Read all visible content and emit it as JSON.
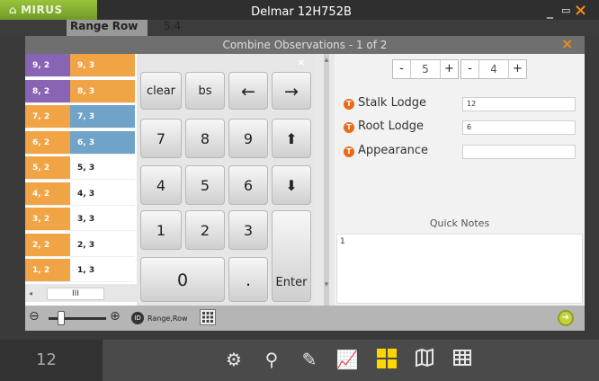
{
  "app": {
    "logo": "MIRUS",
    "title": "Delmar 12H752B"
  },
  "background": {
    "range_row_header": "Range Row",
    "number": "5.4"
  },
  "dialog": {
    "title": "Combine Observations - 1 of 2",
    "grid": {
      "rows": [
        {
          "left": "9, 2",
          "left_color": "purple",
          "right": "9, 3",
          "right_color": "orange"
        },
        {
          "left": "8, 2",
          "left_color": "purple",
          "right": "8, 3",
          "right_color": "orange"
        },
        {
          "left": "7, 2",
          "left_color": "orange",
          "right": "7, 3",
          "right_color": "blue"
        },
        {
          "left": "6, 2",
          "left_color": "orange",
          "right": "6, 3",
          "right_color": "blue"
        },
        {
          "left": "5, 2",
          "left_color": "orange",
          "right": "5, 3",
          "right_color": "white"
        },
        {
          "left": "4, 2",
          "left_color": "orange",
          "right": "4, 3",
          "right_color": "white"
        },
        {
          "left": "3, 2",
          "left_color": "orange",
          "right": "3, 3",
          "right_color": "white"
        },
        {
          "left": "2, 2",
          "left_color": "orange",
          "right": "2, 3",
          "right_color": "white"
        },
        {
          "left": "1, 2",
          "left_color": "orange",
          "right": "1, 3",
          "right_color": "white"
        }
      ],
      "scroll_thumb_label": "III"
    },
    "keypad": {
      "clear": "clear",
      "backspace": "bs",
      "left": "←",
      "right": "→",
      "seven": "7",
      "eight": "8",
      "nine": "9",
      "up": "⬆",
      "four": "4",
      "five": "5",
      "six": "6",
      "down": "⬇",
      "one": "1",
      "two": "2",
      "three": "3",
      "zero": "0",
      "dot": ".",
      "enter": "Enter",
      "close": "×"
    },
    "steppers": [
      {
        "minus": "-",
        "value": "5",
        "plus": "+"
      },
      {
        "minus": "-",
        "value": "4",
        "plus": "+"
      }
    ],
    "observations": [
      {
        "label": "Stalk Lodge",
        "value": "12"
      },
      {
        "label": "Root Lodge",
        "value": "6"
      },
      {
        "label": "Appearance",
        "value": ""
      }
    ],
    "quick_notes": {
      "title": "Quick Notes",
      "content": "1"
    },
    "toolbar": {
      "range_row_label": "Range,Row"
    }
  },
  "bottom": {
    "current_number": "12"
  },
  "colors": {
    "orange": "#f0a446",
    "purple": "#8a64b4",
    "blue": "#6fa3c8",
    "accent": "#f08a1f",
    "highlight": "#ffd600"
  }
}
